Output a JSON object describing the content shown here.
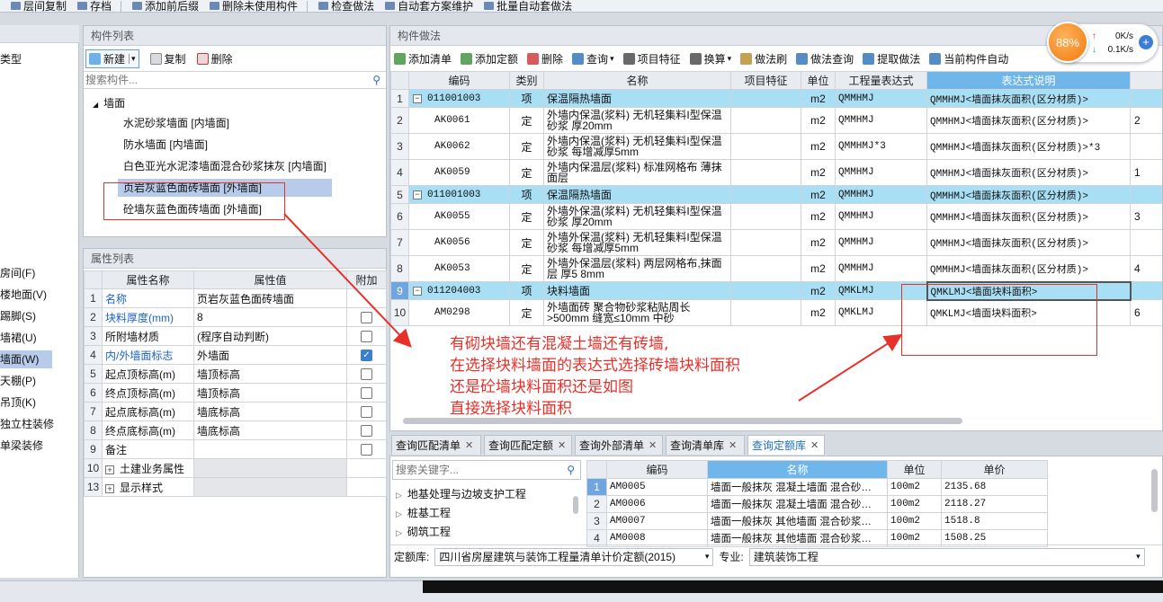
{
  "toolbar_top": {
    "items": [
      "层间复制",
      "存档",
      "添加前后缀",
      "删除未使用构件",
      "检查做法",
      "自动套方案维护",
      "批量自动套做法"
    ]
  },
  "left_nav": {
    "header": "类型",
    "items": [
      "房间(F)",
      "楼地面(V)",
      "踢脚(S)",
      "墙裙(U)",
      "墙面(W)",
      "天棚(P)",
      "吊顶(K)",
      "独立柱装修",
      "单梁装修"
    ],
    "selected_index": 4
  },
  "component_list": {
    "title": "构件列表",
    "new_label": "新建",
    "copy_label": "复制",
    "delete_label": "删除",
    "search_placeholder": "搜索构件...",
    "root": "墙面",
    "items": [
      "水泥砂浆墙面 [内墙面]",
      "防水墙面 [内墙面]",
      "白色亚光水泥漆墙面混合砂浆抹灰 [内墙面]",
      "页岩灰蓝色面砖墙面 [外墙面]",
      "砼墙灰蓝色面砖墙面 [外墙面]"
    ],
    "selected_index": 3
  },
  "property_list": {
    "title": "属性列表",
    "col_name": "属性名称",
    "col_value": "属性值",
    "col_add": "附加",
    "rows": [
      {
        "no": "1",
        "name": "名称",
        "value": "页岩灰蓝色面砖墙面",
        "check": "none",
        "blue": true
      },
      {
        "no": "2",
        "name": "块料厚度(mm)",
        "value": "8",
        "check": "off",
        "blue": true
      },
      {
        "no": "3",
        "name": "所附墙材质",
        "value": "(程序自动判断)",
        "check": "off",
        "blue": false
      },
      {
        "no": "4",
        "name": "内/外墙面标志",
        "value": "外墙面",
        "check": "on",
        "blue": true
      },
      {
        "no": "5",
        "name": "起点顶标高(m)",
        "value": "墙顶标高",
        "check": "off",
        "blue": false
      },
      {
        "no": "6",
        "name": "终点顶标高(m)",
        "value": "墙顶标高",
        "check": "off",
        "blue": false
      },
      {
        "no": "7",
        "name": "起点底标高(m)",
        "value": "墙底标高",
        "check": "off",
        "blue": false
      },
      {
        "no": "8",
        "name": "终点底标高(m)",
        "value": "墙底标高",
        "check": "off",
        "blue": false
      },
      {
        "no": "9",
        "name": "备注",
        "value": "",
        "check": "off",
        "blue": false
      },
      {
        "no": "10",
        "name": "土建业务属性",
        "value": "",
        "check": "none",
        "blue": false,
        "expand": true
      },
      {
        "no": "13",
        "name": "显示样式",
        "value": "",
        "check": "none",
        "blue": false,
        "expand": true
      }
    ]
  },
  "method_panel": {
    "title": "构件做法",
    "toolbar": [
      "添加清单",
      "添加定额",
      "删除",
      "查询",
      "项目特征",
      "换算",
      "做法刷",
      "做法查询",
      "提取做法",
      "当前构件自动"
    ],
    "columns": [
      "编码",
      "类别",
      "名称",
      "项目特征",
      "单位",
      "工程量表达式",
      "表达式说明"
    ],
    "rows": [
      {
        "no": "1",
        "code": "011001003",
        "type": "项",
        "name": "保温隔热墙面",
        "unit": "m2",
        "expr": "QMMHMJ",
        "desc": "QMMHMJ<墙面抹灰面积(区分材质)>",
        "extra": "",
        "list": true
      },
      {
        "no": "2",
        "code": "AK0061",
        "type": "定",
        "name": "外墙内保温(浆料) 无机轻集料I型保温砂浆 厚20mm",
        "unit": "m2",
        "expr": "QMMHMJ",
        "desc": "QMMHMJ<墙面抹灰面积(区分材质)>",
        "extra": "2",
        "list": false
      },
      {
        "no": "3",
        "code": "AK0062",
        "type": "定",
        "name": "外墙内保温(浆料) 无机轻集料I型保温砂浆 每增减厚5mm",
        "unit": "m2",
        "expr": "QMMHMJ*3",
        "desc": "QMMHMJ<墙面抹灰面积(区分材质)>*3",
        "extra": "",
        "list": false
      },
      {
        "no": "4",
        "code": "AK0059",
        "type": "定",
        "name": "外墙内保温层(浆料) 标准网格布 薄抹面层",
        "unit": "m2",
        "expr": "QMMHMJ",
        "desc": "QMMHMJ<墙面抹灰面积(区分材质)>",
        "extra": "1",
        "list": false
      },
      {
        "no": "5",
        "code": "011001003",
        "type": "项",
        "name": "保温隔热墙面",
        "unit": "m2",
        "expr": "QMMHMJ",
        "desc": "QMMHMJ<墙面抹灰面积(区分材质)>",
        "extra": "",
        "list": true
      },
      {
        "no": "6",
        "code": "AK0055",
        "type": "定",
        "name": "外墙外保温(浆料) 无机轻集料I型保温砂浆 厚20mm",
        "unit": "m2",
        "expr": "QMMHMJ",
        "desc": "QMMHMJ<墙面抹灰面积(区分材质)>",
        "extra": "3",
        "list": false
      },
      {
        "no": "7",
        "code": "AK0056",
        "type": "定",
        "name": "外墙外保温(浆料) 无机轻集料I型保温砂浆 每增减厚5mm",
        "unit": "m2",
        "expr": "QMMHMJ",
        "desc": "QMMHMJ<墙面抹灰面积(区分材质)>",
        "extra": "",
        "list": false
      },
      {
        "no": "8",
        "code": "AK0053",
        "type": "定",
        "name": "外墙外保温层(浆料) 两层网格布,抹面层 厚5 8mm",
        "unit": "m2",
        "expr": "QMMHMJ",
        "desc": "QMMHMJ<墙面抹灰面积(区分材质)>",
        "extra": "4",
        "list": false
      },
      {
        "no": "9",
        "code": "011204003",
        "type": "项",
        "name": "块料墙面",
        "unit": "m2",
        "expr": "QMKLMJ",
        "desc": "QMKLMJ<墙面块料面积>",
        "extra": "",
        "list": true
      },
      {
        "no": "10",
        "code": "AM0298",
        "type": "定",
        "name": "外墙面砖 聚合物砂浆粘贴周长>500mm 缝宽≤10mm 中砂",
        "unit": "m2",
        "expr": "QMKLMJ",
        "desc": "QMKLMJ<墙面块料面积>",
        "extra": "6",
        "list": false
      }
    ]
  },
  "annotation": {
    "lines": [
      "有砌块墙还有混凝土墙还有砖墙,",
      "在选择块料墙面的表达式选择砖墙块料面积",
      "还是砼墙块料面积还是如图",
      "直接选择块料面积"
    ]
  },
  "bottom_panel": {
    "tabs": [
      "查询匹配清单",
      "查询匹配定额",
      "查询外部清单",
      "查询清单库",
      "查询定额库"
    ],
    "active_tab": 4,
    "search_placeholder": "搜索关键字...",
    "tree": [
      "地基处理与边坡支护工程",
      "桩基工程",
      "砌筑工程"
    ],
    "columns": [
      "编码",
      "名称",
      "单位",
      "单价"
    ],
    "rows": [
      {
        "no": "1",
        "code": "AM0005",
        "name": "墙面一般抹灰 混凝土墙面 混合砂…",
        "unit": "100m2",
        "price": "2135.68"
      },
      {
        "no": "2",
        "code": "AM0006",
        "name": "墙面一般抹灰 混凝土墙面 混合砂…",
        "unit": "100m2",
        "price": "2118.27"
      },
      {
        "no": "3",
        "code": "AM0007",
        "name": "墙面一般抹灰 其他墙面 混合砂浆…",
        "unit": "100m2",
        "price": "1518.8"
      },
      {
        "no": "4",
        "code": "AM0008",
        "name": "墙面一般抹灰 其他墙面 混合砂浆…",
        "unit": "100m2",
        "price": "1508.25"
      }
    ],
    "quota_label": "定额库:",
    "quota_value": "四川省房屋建筑与装饰工程量清单计价定额(2015)",
    "major_label": "专业:",
    "major_value": "建筑装饰工程"
  },
  "speed_widget": {
    "percent": "88%",
    "up": "0K/s",
    "down": "0.1K/s"
  },
  "colors": {
    "list_row": "#a9dff5",
    "annotation": "#e8302a",
    "selected": "#b7cbea"
  }
}
